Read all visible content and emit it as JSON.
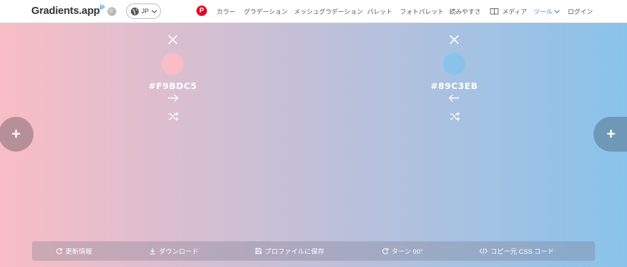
{
  "header": {
    "logo_text": "Gradients.app",
    "logo_suffix": "jp",
    "language": "JP",
    "pinterest_glyph": "P",
    "nav": {
      "colors": "カラー",
      "gradients": "グラデーション",
      "mesh_gradients": "メッシュグラデーション",
      "palettes": "パレット",
      "photo_palettes": "フォトパレット",
      "readability": "読みやすさ",
      "media": "メディア",
      "tools": "ツール",
      "login": "ログイン"
    }
  },
  "gradient": {
    "stops": [
      {
        "hex": "#F9BDC5",
        "color": "#F9BDC5",
        "arrow": "→"
      },
      {
        "hex": "#89C3EB",
        "color": "#89C3EB",
        "arrow": "←"
      }
    ],
    "add_glyph": "+"
  },
  "toolbar": {
    "update": "更新情報",
    "download": "ダウンロード",
    "save_profile": "プロファイルに保存",
    "turn": "ターン 90°",
    "copy_css": "コピー元 CSS コード"
  },
  "colors": {
    "accent": "#3b8fe0",
    "pinterest": "#e60023"
  }
}
